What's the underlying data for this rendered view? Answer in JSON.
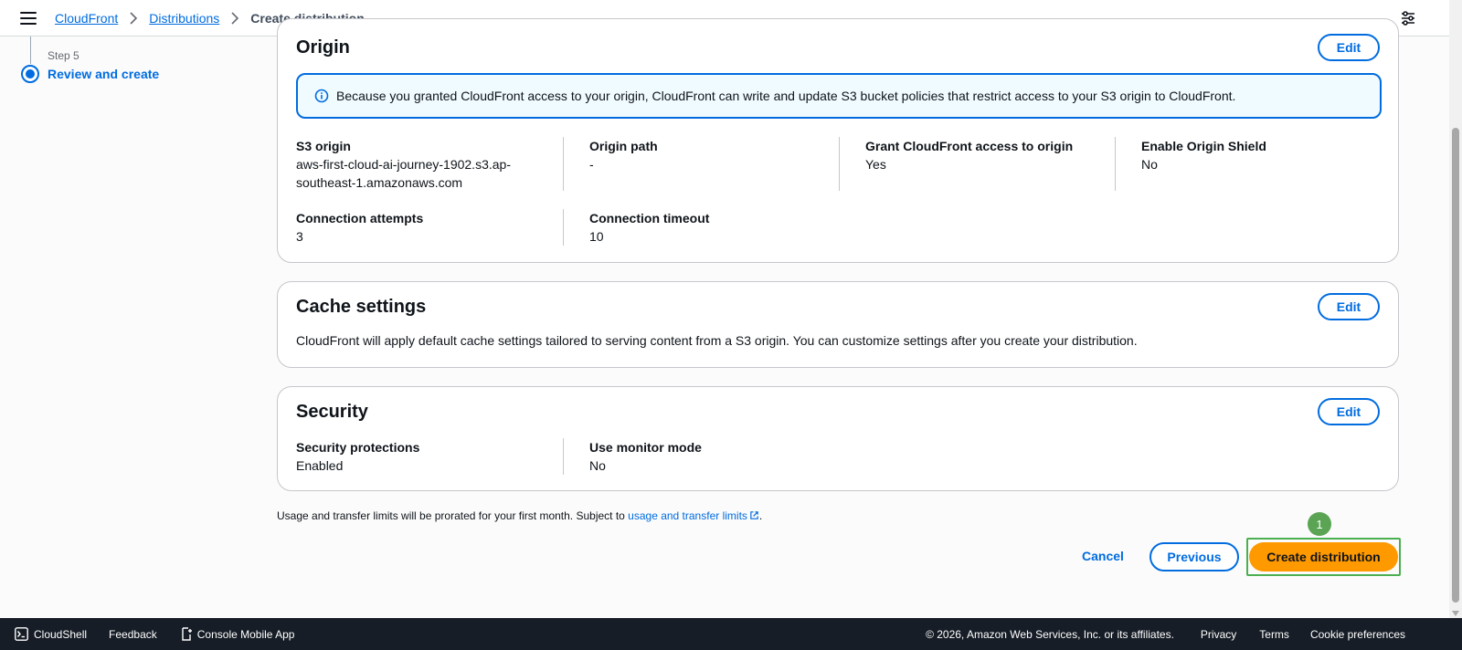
{
  "breadcrumb": {
    "items": [
      "CloudFront",
      "Distributions"
    ],
    "current": "Create distribution"
  },
  "steps": {
    "step_number": "Step 5",
    "step_label": "Review and create"
  },
  "origin": {
    "title": "Origin",
    "edit_label": "Edit",
    "info_text": "Because you granted CloudFront access to your origin, CloudFront can write and update S3 bucket policies that restrict access to your S3 origin to CloudFront.",
    "fields": [
      {
        "label": "S3 origin",
        "value_line1": "aws-first-cloud-ai-journey-1902.s3.ap-",
        "value_line2": "southeast-1.amazonaws.com"
      },
      {
        "label": "Origin path",
        "value": "-"
      },
      {
        "label": "Grant CloudFront access to origin",
        "value": "Yes"
      },
      {
        "label": "Enable Origin Shield",
        "value": "No"
      },
      {
        "label": "Connection attempts",
        "value": "3"
      },
      {
        "label": "Connection timeout",
        "value": "10"
      }
    ]
  },
  "cache": {
    "title": "Cache settings",
    "edit_label": "Edit",
    "text": "CloudFront will apply default cache settings tailored to serving content from a S3 origin. You can customize settings after you create your distribution."
  },
  "security": {
    "title": "Security",
    "edit_label": "Edit",
    "fields": [
      {
        "label": "Security protections",
        "value": "Enabled"
      },
      {
        "label": "Use monitor mode",
        "value": "No"
      }
    ]
  },
  "usage": {
    "text": "Usage and transfer limits will be prorated for your first month. Subject to ",
    "link": "usage and transfer limits",
    "suffix": "."
  },
  "actions": {
    "cancel": "Cancel",
    "previous": "Previous",
    "create": "Create distribution",
    "badge": "1"
  },
  "footer": {
    "cloudshell": "CloudShell",
    "feedback": "Feedback",
    "mobile": "Console Mobile App",
    "copyright": "© 2026, Amazon Web Services, Inc. or its affiliates.",
    "privacy": "Privacy",
    "terms": "Terms",
    "cookies": "Cookie preferences"
  },
  "colors": {
    "primary": "#006ce0",
    "create_button": "#ff9900",
    "highlight": "#4caf50",
    "footer_bg": "#161d26"
  },
  "icons": [
    "menu-icon",
    "settings-icon",
    "info-icon",
    "external-link-icon",
    "cloudshell-icon",
    "mobile-app-icon"
  ]
}
